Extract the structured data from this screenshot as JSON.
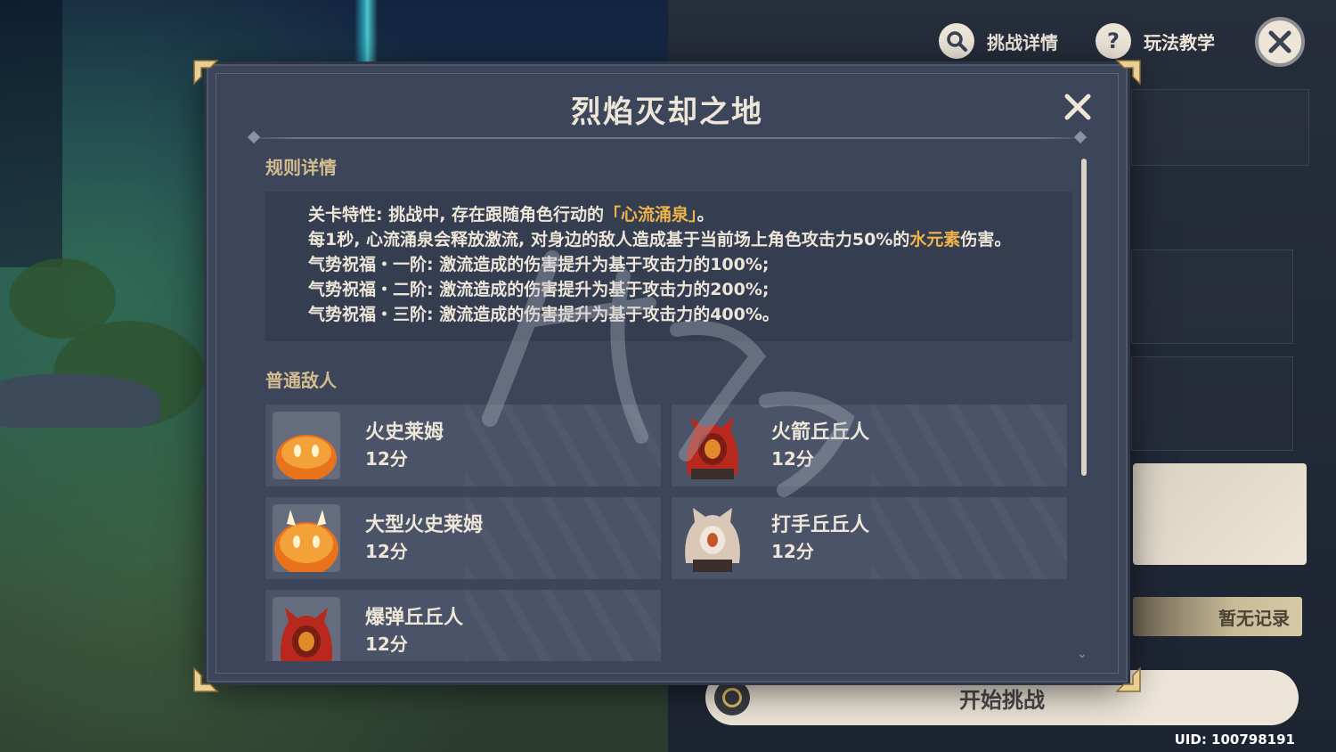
{
  "top_bar": {
    "challenge_details_label": "挑战详情",
    "tutorial_label": "玩法教学",
    "challenge_details_icon": "search-icon",
    "tutorial_icon": "question-icon",
    "close_icon": "close-icon"
  },
  "modal": {
    "title": "烈焰灭却之地",
    "rules": {
      "heading": "规则详情",
      "line1_prefix": "关卡特性: 挑战中, 存在跟随角色行动的",
      "line1_highlight": "「心流涌泉」",
      "line1_suffix": "。",
      "line2_prefix": "每1秒, 心流涌泉会释放激流, 对身边的敌人造成基于当前场上角色攻击力50%的",
      "line2_highlight": "水元素",
      "line2_suffix": "伤害。",
      "line3": "气势祝福・一阶: 激流造成的伤害提升为基于攻击力的100%;",
      "line4": "气势祝福・二阶: 激流造成的伤害提升为基于攻击力的200%;",
      "line5": "气势祝福・三阶: 激流造成的伤害提升为基于攻击力的400%。"
    },
    "enemies": {
      "heading": "普通敌人",
      "list": [
        {
          "name": "火史莱姆",
          "score": "12分",
          "icon": "pyro-slime-icon"
        },
        {
          "name": "火箭丘丘人",
          "score": "12分",
          "icon": "pyro-hilichurl-icon"
        },
        {
          "name": "大型火史莱姆",
          "score": "12分",
          "icon": "large-pyro-slime-icon"
        },
        {
          "name": "打手丘丘人",
          "score": "12分",
          "icon": "hilichurl-fighter-icon"
        },
        {
          "name": "爆弹丘丘人",
          "score": "12分",
          "icon": "bomb-hilichurl-icon"
        }
      ]
    }
  },
  "right_panel": {
    "no_record_label": "暂无记录",
    "start_label": "开始挑战",
    "uid": "UID: 100798191"
  },
  "colors": {
    "accent_gold": "#d3bc8e",
    "highlight_orange": "#f0b24a",
    "text_light": "#ece5d8",
    "modal_bg": "#3c4559"
  }
}
